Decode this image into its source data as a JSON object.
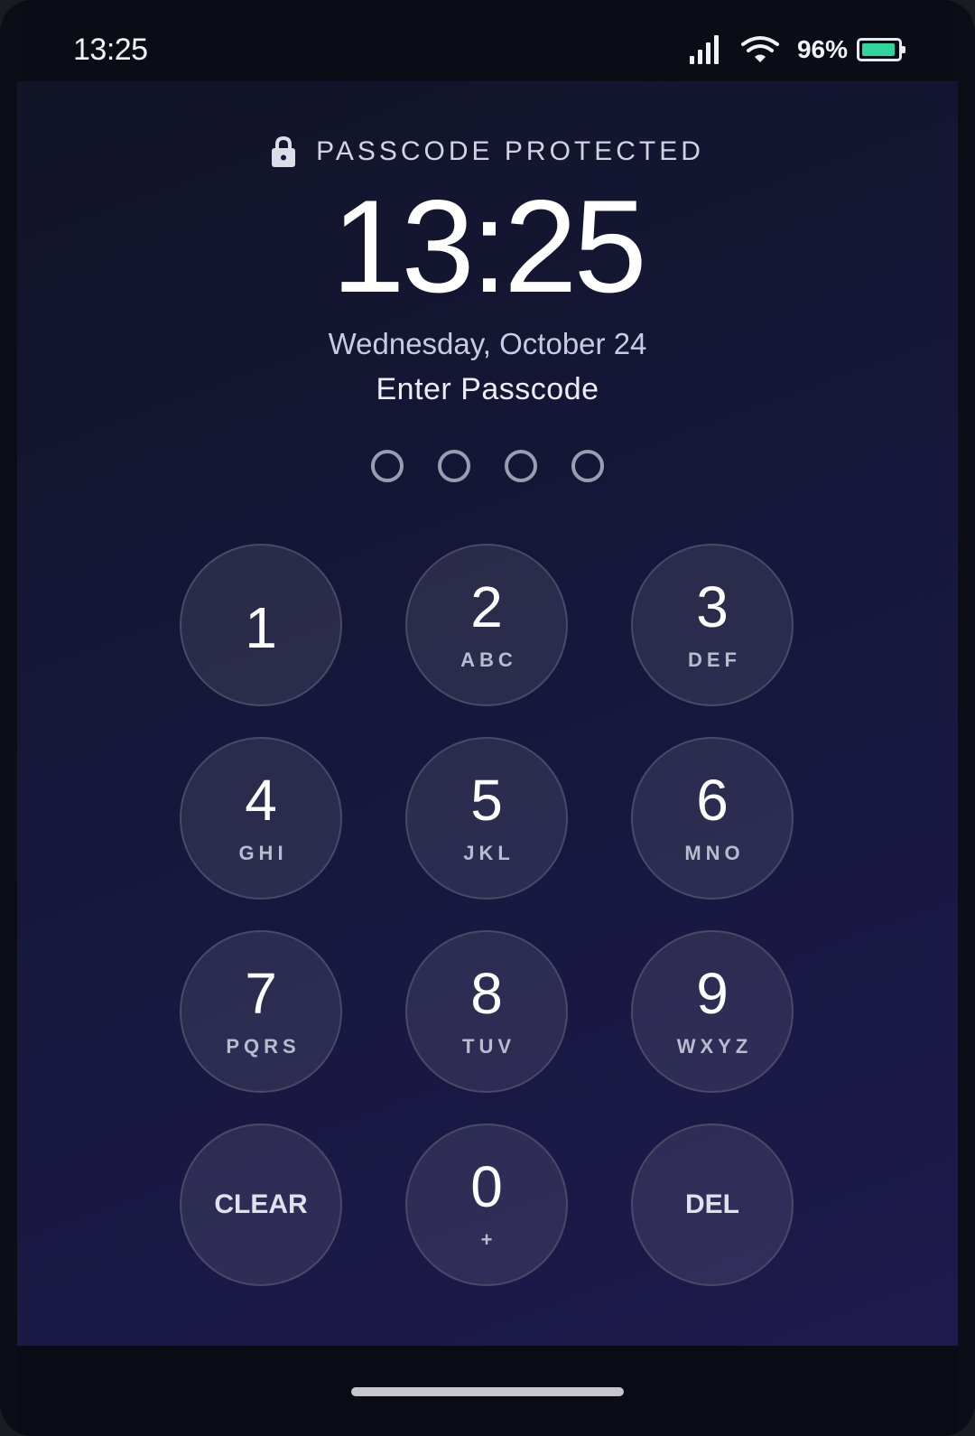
{
  "status_bar": {
    "time": "13:25",
    "battery_percent_label": "96%",
    "battery_level": 0.96,
    "icons": [
      "signal-icon",
      "wifi-icon",
      "battery-icon"
    ]
  },
  "lock_screen": {
    "protected_label": "PASSCODE PROTECTED",
    "time": "13:25",
    "date": "Wednesday, October 24",
    "prompt": "Enter Passcode",
    "passcode_length": 4,
    "digits_entered": 0
  },
  "keypad": {
    "keys": [
      {
        "digit": "1",
        "letters": ""
      },
      {
        "digit": "2",
        "letters": "ABC"
      },
      {
        "digit": "3",
        "letters": "DEF"
      },
      {
        "digit": "4",
        "letters": "GHI"
      },
      {
        "digit": "5",
        "letters": "JKL"
      },
      {
        "digit": "6",
        "letters": "MNO"
      },
      {
        "digit": "7",
        "letters": "PQRS"
      },
      {
        "digit": "8",
        "letters": "TUV"
      },
      {
        "digit": "9",
        "letters": "WXYZ"
      }
    ],
    "clear_label": "CLEAR",
    "zero": {
      "digit": "0",
      "letters": "+"
    },
    "delete_label": "DEL"
  },
  "colors": {
    "background_top": "#121428",
    "background_bottom": "#1e1a4d",
    "battery_fill": "#2fd59a",
    "key_border": "#4a4a68"
  }
}
